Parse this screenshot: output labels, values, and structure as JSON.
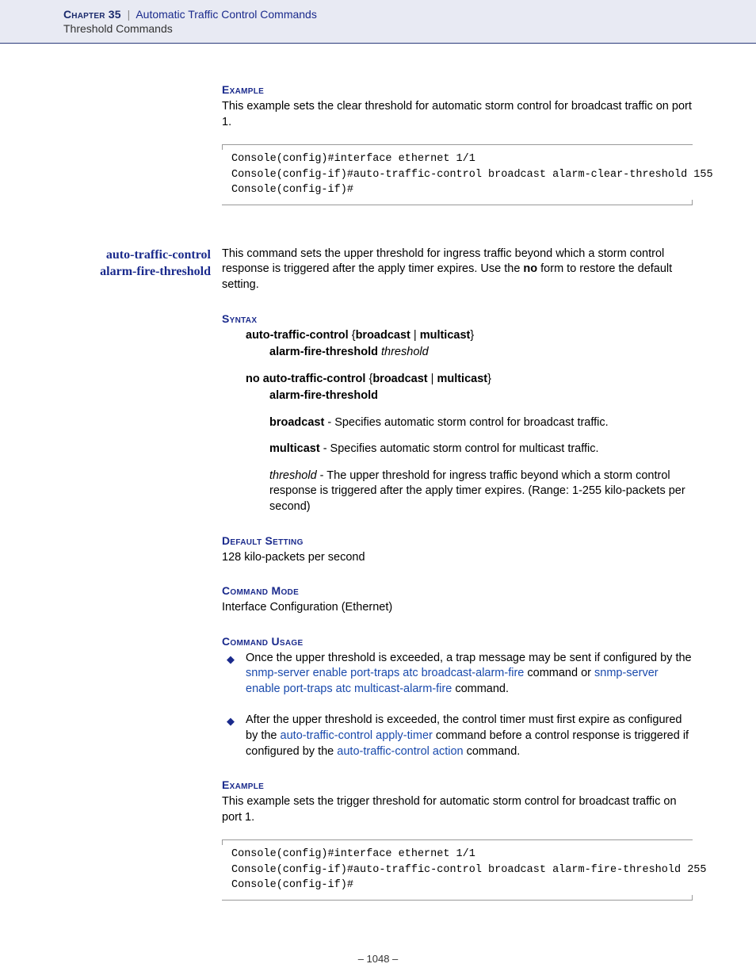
{
  "header": {
    "chapter_label": "Chapter 35",
    "chapter_title": "Automatic Traffic Control Commands",
    "subheader": "Threshold Commands"
  },
  "sec1": {
    "heading": "Example",
    "para": "This example sets the clear threshold for automatic storm control for broadcast traffic on port 1.",
    "code": "Console(config)#interface ethernet 1/1\nConsole(config-if)#auto-traffic-control broadcast alarm-clear-threshold 155\nConsole(config-if)#"
  },
  "cmd": {
    "margin_line1": "auto-traffic-control",
    "margin_line2": "alarm-fire-threshold",
    "intro_pre": "This command sets the upper threshold for ingress traffic beyond which a storm control response is triggered after the apply timer expires. Use the ",
    "intro_bold": "no",
    "intro_post": " form to restore the default setting."
  },
  "syntax": {
    "heading": "Syntax",
    "l1a_b1": "auto-traffic-control",
    "l1a_t1": " {",
    "l1a_b2": "broadcast",
    "l1a_t2": " | ",
    "l1a_b3": "multicast",
    "l1a_t3": "} ",
    "l1b_b1": "alarm-fire-threshold",
    "l1b_i1": " threshold",
    "l2a_b1": "no auto-traffic-control",
    "l2a_t1": " {",
    "l2a_b2": "broadcast",
    "l2a_t2": " | ",
    "l2a_b3": "multicast",
    "l2a_t3": "} ",
    "l2b_b1": "alarm-fire-threshold",
    "p1_b": "broadcast",
    "p1_t": " - Specifies automatic storm control for broadcast traffic.",
    "p2_b": "multicast",
    "p2_t": " - Specifies automatic storm control for multicast traffic.",
    "p3_i": "threshold",
    "p3_t": " - The upper threshold for ingress traffic beyond which a storm control response is triggered after the apply timer expires. (Range: 1-255 kilo-packets per second)"
  },
  "default": {
    "heading": "Default Setting",
    "text": "128 kilo-packets per second"
  },
  "mode": {
    "heading": "Command Mode",
    "text": "Interface Configuration (Ethernet)"
  },
  "usage": {
    "heading": "Command Usage",
    "b1_t1": "Once the upper threshold is exceeded, a trap message may be sent if configured by the ",
    "b1_l1": "snmp-server enable port-traps atc broadcast-alarm-fire",
    "b1_t2": " command or ",
    "b1_l2": "snmp-server enable port-traps atc multicast-alarm-fire",
    "b1_t3": " command.",
    "b2_t1": "After the upper threshold is exceeded, the control timer must first expire as configured by the ",
    "b2_l1": "auto-traffic-control apply-timer",
    "b2_t2": " command before a control response is triggered if configured by the ",
    "b2_l2": "auto-traffic-control action",
    "b2_t3": " command."
  },
  "example2": {
    "heading": "Example",
    "para": "This example sets the trigger threshold for automatic storm control for broadcast traffic on port 1.",
    "code": "Console(config)#interface ethernet 1/1\nConsole(config-if)#auto-traffic-control broadcast alarm-fire-threshold 255\nConsole(config-if)#"
  },
  "page_number": "–  1048  –"
}
